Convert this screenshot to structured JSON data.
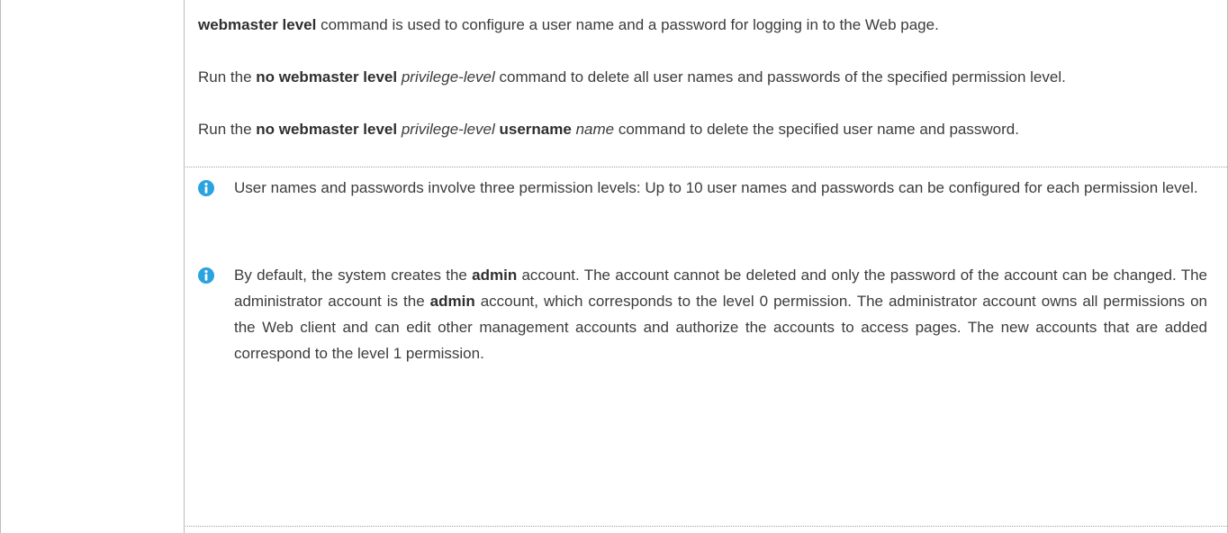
{
  "paragraphs": [
    {
      "id": "p1",
      "segments": [
        {
          "t": "webmaster level",
          "b": true
        },
        {
          "t": " command is used to configure a user name and a password for logging in to the Web page."
        }
      ]
    },
    {
      "id": "p2",
      "segments": [
        {
          "t": "Run the "
        },
        {
          "t": "no webmaster level",
          "b": true
        },
        {
          "t": " "
        },
        {
          "t": "privilege-level",
          "i": true
        },
        {
          "t": " command to delete all user names and passwords of the specified permission level."
        }
      ]
    },
    {
      "id": "p3",
      "segments": [
        {
          "t": "Run the "
        },
        {
          "t": "no webmaster level",
          "b": true
        },
        {
          "t": " "
        },
        {
          "t": "privilege-level",
          "i": true
        },
        {
          "t": " "
        },
        {
          "t": "username",
          "b": true
        },
        {
          "t": " "
        },
        {
          "t": "name",
          "i": true
        },
        {
          "t": " command to delete the specified user name and password."
        }
      ]
    }
  ],
  "notes": [
    {
      "icon": "info-icon",
      "segments": [
        {
          "t": "User names and passwords involve three permission levels: Up to 10 user names and passwords can be configured for each permission level."
        }
      ]
    },
    {
      "icon": "info-icon",
      "segments": [
        {
          "t": "By default, the system creates the "
        },
        {
          "t": "admin",
          "b": true
        },
        {
          "t": " account. The account cannot be deleted and only the password of the account can be changed. The administrator account is the "
        },
        {
          "t": "admin",
          "b": true
        },
        {
          "t": " account, which corresponds to the level 0 permission. The administrator account owns all permissions on the Web client and can edit other management accounts and authorize the accounts to access pages. The new accounts that are added correspond to the level 1 permission."
        }
      ]
    }
  ],
  "colors": {
    "info_icon": "#2aa3e0",
    "text": "#3c3c3c",
    "border": "#bdbdbd"
  }
}
